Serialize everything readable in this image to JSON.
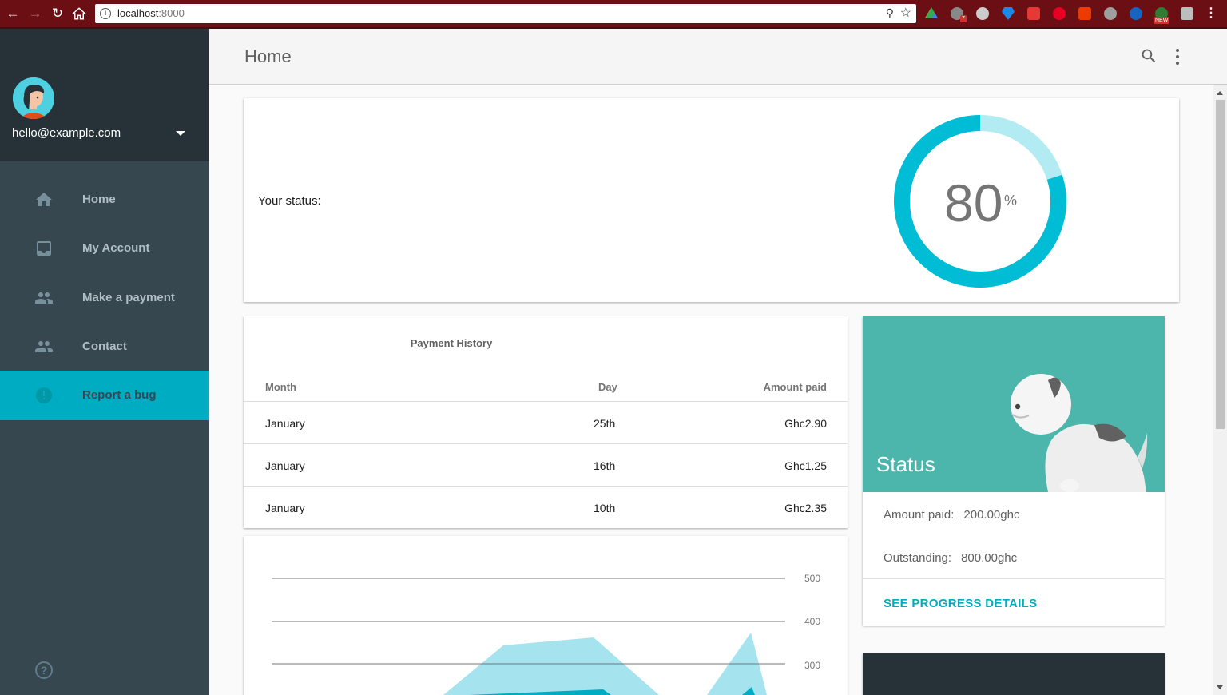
{
  "browser": {
    "url_host": "localhost",
    "url_port": ":8000",
    "extension_badge_count": "7",
    "extension_new_badge": "NEW"
  },
  "sidebar": {
    "email": "hello@example.com",
    "items": [
      {
        "label": "Home",
        "icon": "home-icon"
      },
      {
        "label": "My Account",
        "icon": "inbox-icon"
      },
      {
        "label": "Make a payment",
        "icon": "people-icon"
      },
      {
        "label": "Contact",
        "icon": "people-icon"
      },
      {
        "label": "Report a bug",
        "icon": "report-icon",
        "active": true
      }
    ],
    "help_glyph": "?"
  },
  "appbar": {
    "title": "Home"
  },
  "status_card": {
    "label": "Your status:",
    "value": "80",
    "unit": "%",
    "fraction": 0.8,
    "ring_color": "#00bcd4",
    "track_color": "#b2ebf2"
  },
  "payment_history": {
    "title": "Payment History",
    "columns": [
      "Month",
      "Day",
      "Amount paid"
    ],
    "rows": [
      [
        "January",
        "25th",
        "Ghc2.90"
      ],
      [
        "January",
        "16th",
        "Ghc1.25"
      ],
      [
        "January",
        "10th",
        "Ghc2.35"
      ]
    ]
  },
  "chart_data": {
    "type": "area",
    "y_ticks": [
      "500",
      "400",
      "300"
    ],
    "ylim": [
      0,
      500
    ],
    "grid": true,
    "colors": [
      "#a5e4ef",
      "#00acc1"
    ]
  },
  "dog_card": {
    "title": "Status",
    "amount_paid_label": "Amount paid:",
    "amount_paid_value": "200.00ghc",
    "outstanding_label": "Outstanding:",
    "outstanding_value": "800.00ghc",
    "link_label": "SEE PROGRESS DETAILS",
    "media_color": "#4db6ac"
  },
  "colors": {
    "accent": "#00acc1",
    "sidebar_bg": "#37474f",
    "sidebar_header_bg": "#263238"
  }
}
